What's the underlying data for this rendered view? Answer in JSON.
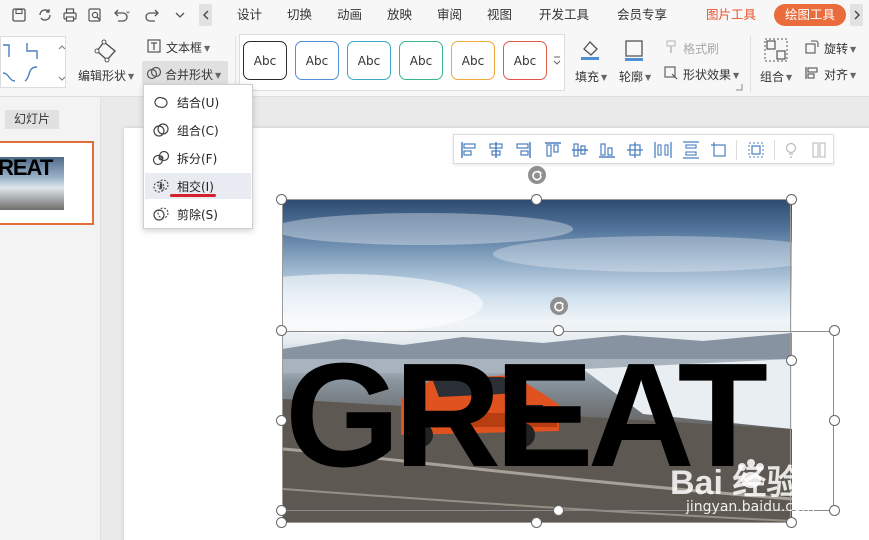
{
  "tabs": {
    "items": [
      {
        "label": "设计"
      },
      {
        "label": "切换"
      },
      {
        "label": "动画"
      },
      {
        "label": "放映"
      },
      {
        "label": "审阅"
      },
      {
        "label": "视图"
      },
      {
        "label": "开发工具"
      },
      {
        "label": "会员专享"
      }
    ],
    "picture_tools": "图片工具",
    "drawing_tools": "绘图工具"
  },
  "ribbon": {
    "edit_shape": "编辑形状",
    "text_box": "文本框",
    "merge_shapes": "合并形状",
    "shape_styles": [
      "Abc",
      "Abc",
      "Abc",
      "Abc",
      "Abc",
      "Abc"
    ],
    "style_colors": [
      "#2b2b2b",
      "#4f8fd6",
      "#38a8c4",
      "#3ab58a",
      "#f0a93c",
      "#e4584a"
    ],
    "fill": "填充",
    "outline": "轮廓",
    "format_painter": "格式刷",
    "shape_effects": "形状效果",
    "group": "组合",
    "rotate": "旋转",
    "align": "对齐"
  },
  "panel": {
    "slides_tab": "幻灯片",
    "thumb_text": "REAT"
  },
  "menu": {
    "items": [
      {
        "label": "结合(U)"
      },
      {
        "label": "组合(C)"
      },
      {
        "label": "拆分(F)"
      },
      {
        "label": "相交(I)"
      },
      {
        "label": "剪除(S)"
      }
    ]
  },
  "slide": {
    "text": "GREAT"
  },
  "watermark": {
    "brand": "Bai  经验",
    "url": "jingyan.baidu.com"
  },
  "colors": {
    "accent": "#ea6b3b",
    "underline": "#d6202a"
  }
}
